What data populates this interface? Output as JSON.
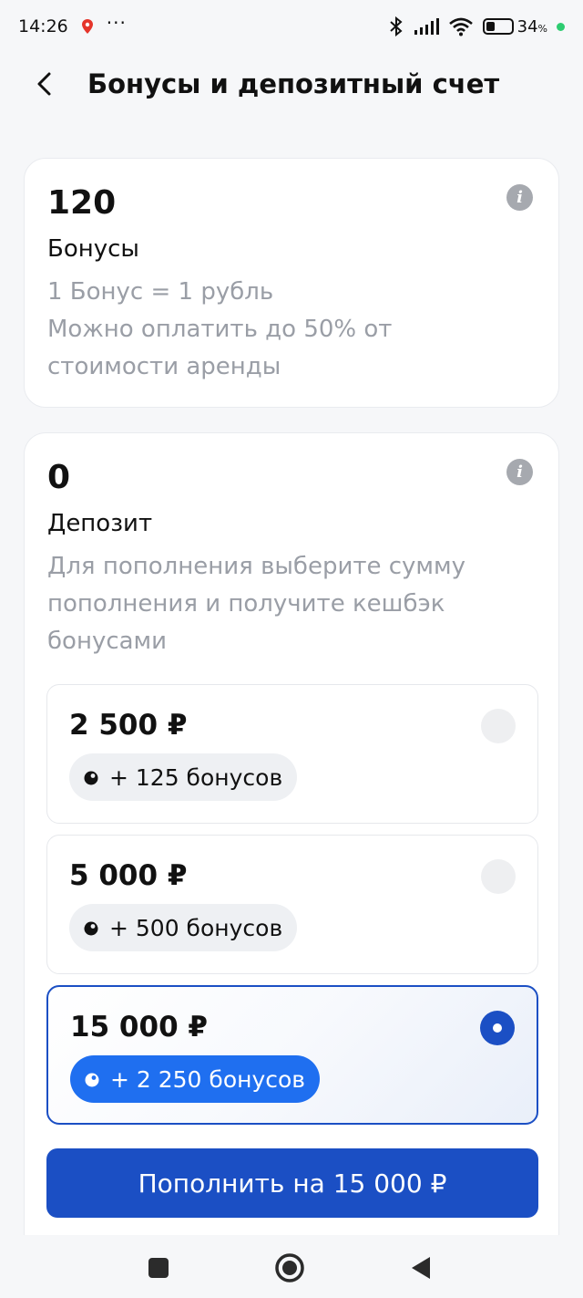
{
  "status_bar": {
    "time": "14:26",
    "dots": "···",
    "battery_percent": "34",
    "battery_unit": "%"
  },
  "header": {
    "title": "Бонусы и депозитный счет"
  },
  "bonus_card": {
    "value": "120",
    "label": "Бонусы",
    "desc_line1": "1 Бонус = 1 рубль",
    "desc_line2": "Можно оплатить до 50% от стоимости аренды"
  },
  "deposit_card": {
    "value": "0",
    "label": "Депозит",
    "desc": "Для пополнения выберите сумму пополнения и получите кешбэк бонусами",
    "options": [
      {
        "amount": "2 500 ₽",
        "bonus": "+ 125 бонусов",
        "selected": false
      },
      {
        "amount": "5 000 ₽",
        "bonus": "+ 500 бонусов",
        "selected": false
      },
      {
        "amount": "15 000 ₽",
        "bonus": "+ 2 250 бонусов",
        "selected": true
      }
    ],
    "cta_label": "Пополнить на 15 000 ₽"
  },
  "colors": {
    "accent": "#1b4fc4",
    "chip_active": "#1f6ff0",
    "muted_text": "#9a9ea6"
  },
  "icons": {
    "back": "arrow-left-icon",
    "info": "info-icon",
    "coin": "coin-icon"
  }
}
